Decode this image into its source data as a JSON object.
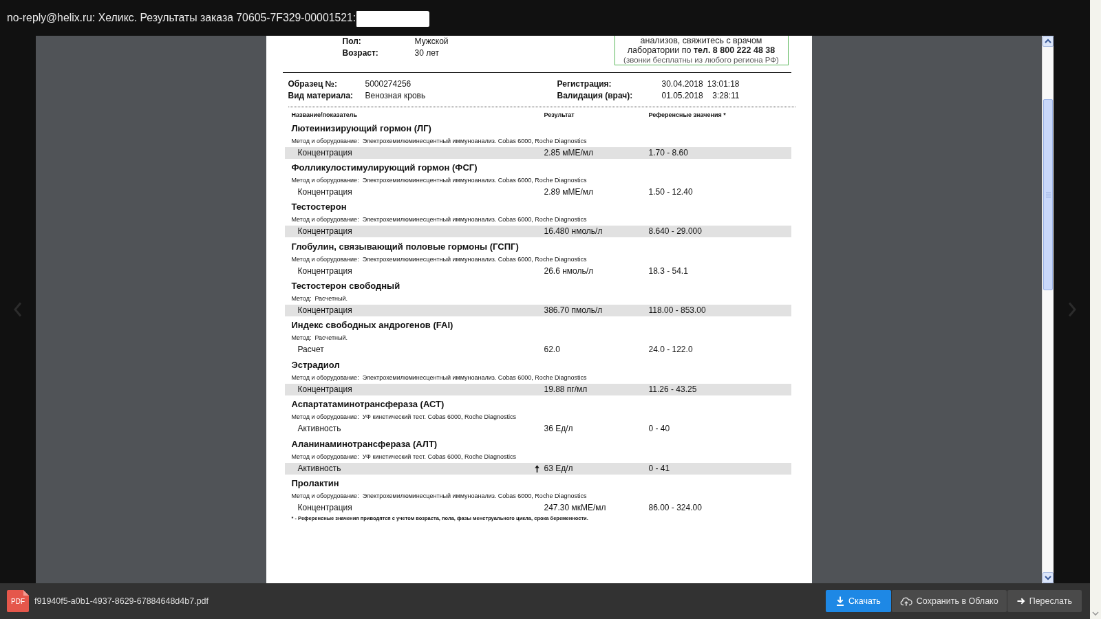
{
  "window": {
    "title": "no-reply@helix.ru: Хеликс. Результаты заказа 70605-7F329-00001521:"
  },
  "document": {
    "patient": [
      {
        "label": "Пол:",
        "value": "Мужской"
      },
      {
        "label": "Возраст:",
        "value": "30 лет"
      }
    ],
    "contact_box": {
      "lines": [
        "анализов, свяжитесь с врачом",
        "лаборатории по **тел. 8 800 222 48 38**"
      ],
      "note": "(звонки бесплатны из любого региона РФ)"
    },
    "sample": [
      {
        "label": "Образец №:",
        "value": "5000274256"
      },
      {
        "label": "Вид материала:",
        "value": "Венозная кровь"
      }
    ],
    "dates": [
      {
        "label": "Регистрация:",
        "date": "30.04.2018",
        "time": "13:01:18"
      },
      {
        "label": "Валидация (врач):",
        "date": "01.05.2018",
        "time": "3:28:11"
      }
    ],
    "columns": [
      "Название/показатель",
      "Результат",
      "Референсные значения *"
    ],
    "tests": [
      {
        "name": "Лютеинизирующий гормон (ЛГ)",
        "method_label": "Метод и оборудование:",
        "method": "Электрохемилюминесцентный иммуноанализ. Cobas 6000, Roche Diagnostics",
        "rows": [
          {
            "parameter": "Концентрация",
            "result": "2.85 мМЕ/мл",
            "reference": "1.70 - 8.60",
            "above_range": false
          }
        ]
      },
      {
        "name": "Фолликулостимулирующий гормон (ФСГ)",
        "method_label": "Метод и оборудование:",
        "method": "Электрохемилюминесцентный иммуноанализ. Cobas 6000, Roche Diagnostics",
        "rows": [
          {
            "parameter": "Концентрация",
            "result": "2.89 мМЕ/мл",
            "reference": "1.50 - 12.40",
            "above_range": false
          }
        ]
      },
      {
        "name": "Тестостерон",
        "method_label": "Метод и оборудование:",
        "method": "Электрохемилюминесцентный иммуноанализ. Cobas 6000, Roche Diagnostics",
        "rows": [
          {
            "parameter": "Концентрация",
            "result": "16.480 нмоль/л",
            "reference": "8.640 - 29.000",
            "above_range": false
          }
        ]
      },
      {
        "name": "Глобулин, связывающий половые гормоны (ГСПГ)",
        "method_label": "Метод и оборудование:",
        "method": "Электрохемилюминесцентный иммуноанализ. Cobas 6000, Roche Diagnostics",
        "rows": [
          {
            "parameter": "Концентрация",
            "result": "26.6 нмоль/л",
            "reference": "18.3 - 54.1",
            "above_range": false
          }
        ]
      },
      {
        "name": "Тестостерон свободный",
        "method_label": "Метод:",
        "method": "Расчетный.",
        "rows": [
          {
            "parameter": "Концентрация",
            "result": "386.70 пмоль/л",
            "reference": "118.00 - 853.00",
            "above_range": false
          }
        ]
      },
      {
        "name": "Индекс свободных андрогенов (FAI)",
        "method_label": "Метод:",
        "method": "Расчетный.",
        "rows": [
          {
            "parameter": "Расчет",
            "result": "62.0",
            "reference": "24.0 - 122.0",
            "above_range": false
          }
        ]
      },
      {
        "name": "Эстрадиол",
        "method_label": "Метод и оборудование:",
        "method": "Электрохемилюминесцентный иммуноанализ. Cobas 6000, Roche Diagnostics",
        "rows": [
          {
            "parameter": "Концентрация",
            "result": "19.88 пг/мл",
            "reference": "11.26 - 43.25",
            "above_range": false
          }
        ]
      },
      {
        "name": "Аспартатаминотрансфераза (АСТ)",
        "method_label": "Метод и оборудование:",
        "method": "УФ кинетический тест. Cobas 6000, Roche Diagnostics",
        "rows": [
          {
            "parameter": "Активность",
            "result": "36 Ед/л",
            "reference": "0 - 40",
            "above_range": false
          }
        ]
      },
      {
        "name": "Аланинаминотрансфераза (АЛТ)",
        "method_label": "Метод и оборудование:",
        "method": "УФ кинетический тест. Cobas 6000, Roche Diagnostics",
        "rows": [
          {
            "parameter": "Активность",
            "result": "63 Ед/л",
            "reference": "0 - 41",
            "above_range": true
          }
        ]
      },
      {
        "name": "Пролактин",
        "method_label": "Метод и оборудование:",
        "method": "Электрохемилюминесцентный иммуноанализ. Cobas 6000, Roche Diagnostics",
        "rows": [
          {
            "parameter": "Концентрация",
            "result": "247.30 мкМЕ/мл",
            "reference": "86.00 - 324.00",
            "above_range": false
          }
        ]
      }
    ],
    "footnote": "* - Референсные значения приводятся с учетом возраста, пола, фазы менструального цикла, срока беременности."
  },
  "attachment": {
    "file_type": "PDF",
    "file_name": "f91940f5-a0b1-4937-8629-67884648d4b7.pdf"
  },
  "actions": [
    {
      "kind": "download",
      "label": "Скачать"
    },
    {
      "kind": "cloud",
      "label": "Сохранить в Облако"
    },
    {
      "kind": "forward",
      "label": "Переслать"
    }
  ]
}
